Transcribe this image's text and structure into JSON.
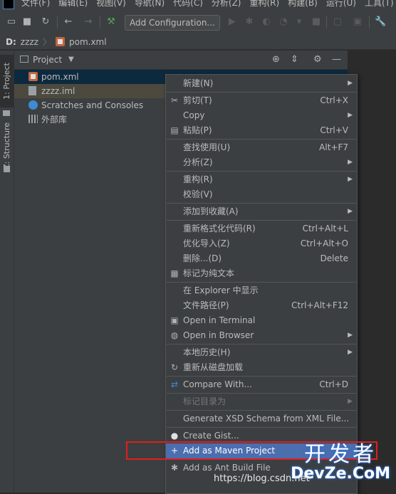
{
  "menubar": {
    "items": [
      "文件(F)",
      "编辑(E)",
      "视图(V)",
      "导航(N)",
      "代码(C)",
      "分析(Z)",
      "重构(R)",
      "构建(B)",
      "运行(U)",
      "工具(T)"
    ]
  },
  "toolbar": {
    "run_config_label": "Add Configuration..."
  },
  "breadcrumb": {
    "drive": "D:",
    "folder": "zzzz",
    "file": "pom.xml"
  },
  "left_stripe": {
    "project_tab": "1: Project",
    "structure_tab": "Z: Structure"
  },
  "project_panel": {
    "title": "Project",
    "tree": [
      {
        "label": "pom.xml",
        "icon": "maven-icon"
      },
      {
        "label": "zzzz.iml",
        "icon": "iml-file-icon"
      },
      {
        "label": "Scratches and Consoles",
        "icon": "scratches-icon"
      },
      {
        "label": "外部库",
        "icon": "external-libraries-icon"
      }
    ]
  },
  "context_menu": {
    "items": [
      {
        "label": "新建(N)",
        "shortcut": "",
        "submenu": true
      },
      {
        "label": "剪切(T)",
        "shortcut": "Ctrl+X",
        "icon": "cut-icon"
      },
      {
        "label": "Copy",
        "shortcut": "",
        "submenu": true
      },
      {
        "label": "粘贴(P)",
        "shortcut": "Ctrl+V",
        "icon": "paste-icon"
      },
      {
        "label": "查找使用(U)",
        "shortcut": "Alt+F7"
      },
      {
        "label": "分析(Z)",
        "shortcut": "",
        "submenu": true
      },
      {
        "label": "重构(R)",
        "shortcut": "",
        "submenu": true
      },
      {
        "label": "校验(V)",
        "shortcut": ""
      },
      {
        "label": "添加到收藏(A)",
        "shortcut": "",
        "submenu": true
      },
      {
        "label": "重新格式化代码(R)",
        "shortcut": "Ctrl+Alt+L"
      },
      {
        "label": "优化导入(Z)",
        "shortcut": "Ctrl+Alt+O"
      },
      {
        "label": "删除...(D)",
        "shortcut": "Delete"
      },
      {
        "label": "标记为纯文本",
        "shortcut": "",
        "icon": "plain-text-icon"
      },
      {
        "label": "在 Explorer 中显示",
        "shortcut": ""
      },
      {
        "label": "文件路径(P)",
        "shortcut": "Ctrl+Alt+F12"
      },
      {
        "label": "Open in Terminal",
        "shortcut": "",
        "icon": "terminal-icon"
      },
      {
        "label": "Open in Browser",
        "shortcut": "",
        "submenu": true,
        "icon": "globe-icon"
      },
      {
        "label": "本地历史(H)",
        "shortcut": "",
        "submenu": true
      },
      {
        "label": "重新从磁盘加载",
        "shortcut": "",
        "icon": "reload-icon"
      },
      {
        "label": "Compare With...",
        "shortcut": "Ctrl+D",
        "icon": "compare-icon"
      },
      {
        "label": "标记目录为",
        "shortcut": "",
        "submenu": true,
        "disabled": true
      },
      {
        "label": "Generate XSD Schema from XML File...",
        "shortcut": ""
      },
      {
        "label": "Create Gist...",
        "shortcut": "",
        "icon": "github-icon"
      },
      {
        "label": "Add as Maven Project",
        "shortcut": "",
        "icon": "plus-icon",
        "highlighted": true
      },
      {
        "label": "Add as Ant Build File",
        "shortcut": "",
        "icon": "ant-icon"
      }
    ]
  },
  "watermark": {
    "brand_cn": "开发者",
    "brand_en": "DevZe.CoM",
    "url": "https://blog.csdn.net"
  },
  "colors": {
    "background": "#2b2b2b",
    "panel": "#3c3f41",
    "selection": "#0d293e",
    "menu_highlight": "#4b6eaf",
    "annotation_red": "#e01e1e"
  }
}
